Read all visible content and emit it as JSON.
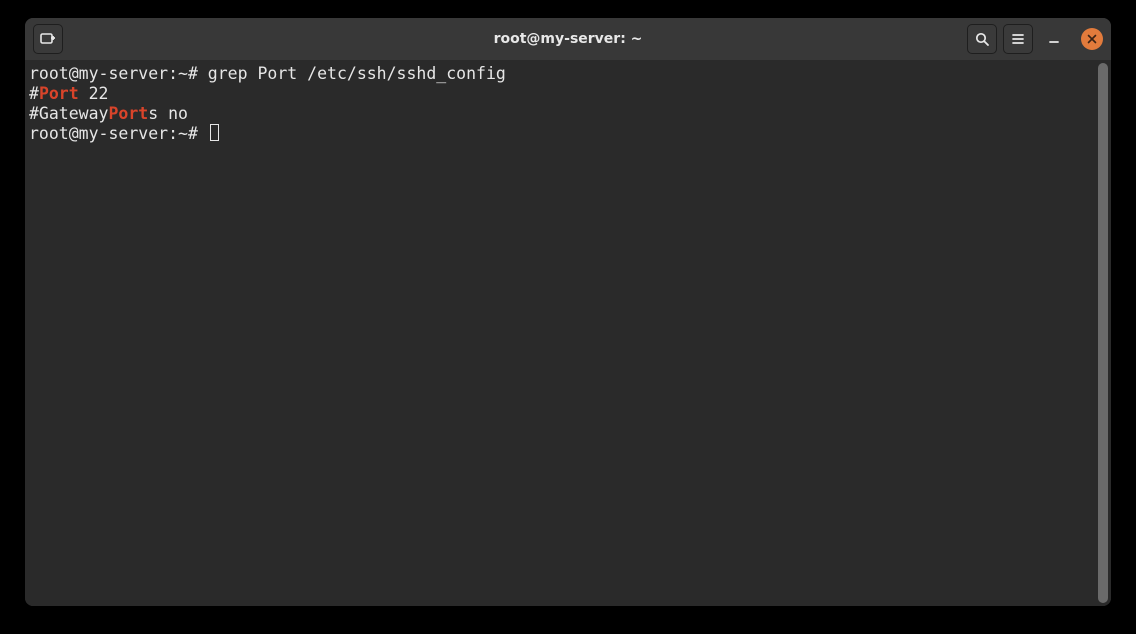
{
  "titlebar": {
    "title": "root@my-server: ~"
  },
  "terminal": {
    "lines": [
      {
        "segments": [
          {
            "text": "root@my-server:~# grep Port /etc/ssh/sshd_config",
            "hl": false
          }
        ]
      },
      {
        "segments": [
          {
            "text": "#",
            "hl": false
          },
          {
            "text": "Port",
            "hl": true
          },
          {
            "text": " 22",
            "hl": false
          }
        ]
      },
      {
        "segments": [
          {
            "text": "#Gateway",
            "hl": false
          },
          {
            "text": "Port",
            "hl": true
          },
          {
            "text": "s no",
            "hl": false
          }
        ]
      },
      {
        "segments": [
          {
            "text": "root@my-server:~# ",
            "hl": false
          }
        ],
        "cursor": true
      }
    ]
  }
}
